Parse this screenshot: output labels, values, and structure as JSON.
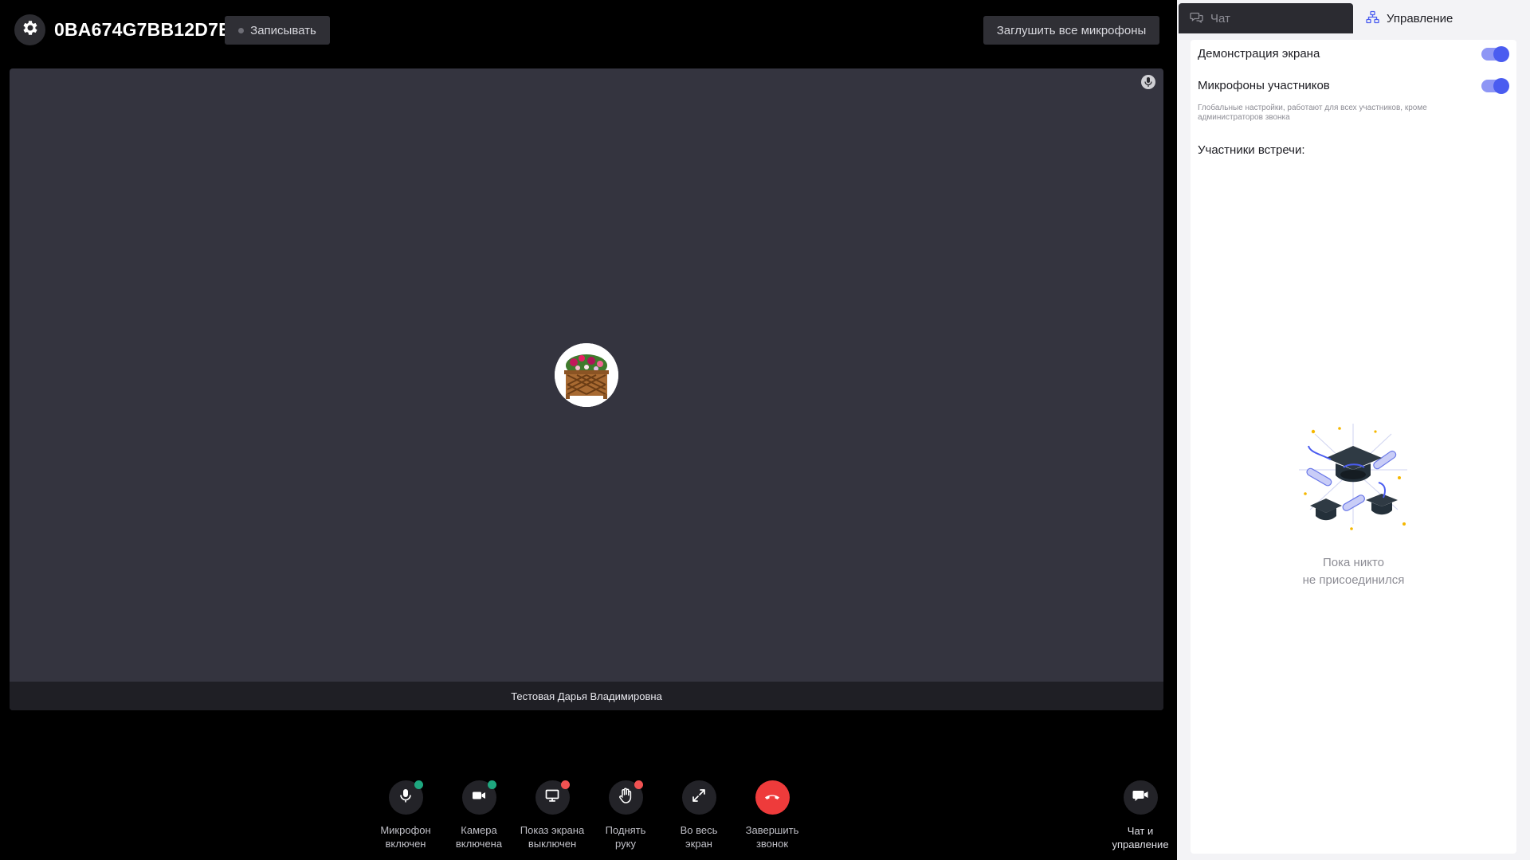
{
  "header": {
    "room_id": "0BA674G7BB12D7E",
    "record_label": "Записывать",
    "mute_all_label": "Заглушить все микрофоны"
  },
  "video": {
    "participant_name": "Тестовая Дарья Владимировна"
  },
  "controls": [
    {
      "label": "Микрофон\nвключен",
      "icon": "mic-icon",
      "status_color": "#1ea77f"
    },
    {
      "label": "Камера\nвключена",
      "icon": "camera-icon",
      "status_color": "#1ea77f"
    },
    {
      "label": "Показ экрана\nвыключен",
      "icon": "monitor-icon",
      "status_color": "#f05252"
    },
    {
      "label": "Поднять\nруку",
      "icon": "hand-icon",
      "status_color": "#f05252"
    },
    {
      "label": "Во весь\nэкран",
      "icon": "expand-icon"
    },
    {
      "label": "Завершить\nзвонок",
      "icon": "phone-hangup-icon",
      "accent": "#ee3b3b"
    }
  ],
  "chat_control": {
    "label": "Чат и\nуправление",
    "icon": "chat-video-icon"
  },
  "panel": {
    "tabs": [
      {
        "label": "Чат",
        "icon": "chat-bubbles-icon",
        "active": false
      },
      {
        "label": "Управление",
        "icon": "hierarchy-icon",
        "active": true
      }
    ],
    "settings": [
      {
        "label": "Демонстрация экрана",
        "enabled": true
      },
      {
        "label": "Микрофоны участников",
        "enabled": true
      }
    ],
    "hint": "Глобальные настройки, работают для всех участников, кроме администраторов звонка",
    "participants_title": "Участники встречи:",
    "empty_text": "Пока никто\nне присоединился"
  },
  "colors": {
    "toggle_track": "#8e96f5",
    "toggle_knob": "#4a5cf0",
    "tile_bg": "#34343f"
  }
}
